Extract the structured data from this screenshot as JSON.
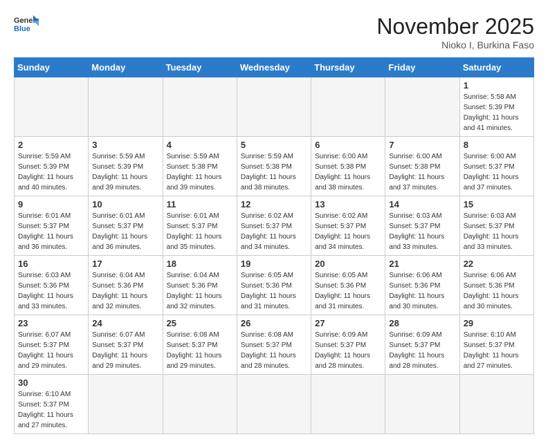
{
  "logo": {
    "text_general": "General",
    "text_blue": "Blue"
  },
  "header": {
    "month": "November 2025",
    "location": "Nioko I, Burkina Faso"
  },
  "weekdays": [
    "Sunday",
    "Monday",
    "Tuesday",
    "Wednesday",
    "Thursday",
    "Friday",
    "Saturday"
  ],
  "weeks": [
    [
      {
        "day": "",
        "sunrise": "",
        "sunset": "",
        "daylight": "",
        "empty": true
      },
      {
        "day": "",
        "sunrise": "",
        "sunset": "",
        "daylight": "",
        "empty": true
      },
      {
        "day": "",
        "sunrise": "",
        "sunset": "",
        "daylight": "",
        "empty": true
      },
      {
        "day": "",
        "sunrise": "",
        "sunset": "",
        "daylight": "",
        "empty": true
      },
      {
        "day": "",
        "sunrise": "",
        "sunset": "",
        "daylight": "",
        "empty": true
      },
      {
        "day": "",
        "sunrise": "",
        "sunset": "",
        "daylight": "",
        "empty": true
      },
      {
        "day": "1",
        "sunrise": "Sunrise: 5:58 AM",
        "sunset": "Sunset: 5:39 PM",
        "daylight": "Daylight: 11 hours and 41 minutes.",
        "empty": false
      }
    ],
    [
      {
        "day": "2",
        "sunrise": "Sunrise: 5:59 AM",
        "sunset": "Sunset: 5:39 PM",
        "daylight": "Daylight: 11 hours and 40 minutes.",
        "empty": false
      },
      {
        "day": "3",
        "sunrise": "Sunrise: 5:59 AM",
        "sunset": "Sunset: 5:39 PM",
        "daylight": "Daylight: 11 hours and 39 minutes.",
        "empty": false
      },
      {
        "day": "4",
        "sunrise": "Sunrise: 5:59 AM",
        "sunset": "Sunset: 5:38 PM",
        "daylight": "Daylight: 11 hours and 39 minutes.",
        "empty": false
      },
      {
        "day": "5",
        "sunrise": "Sunrise: 5:59 AM",
        "sunset": "Sunset: 5:38 PM",
        "daylight": "Daylight: 11 hours and 38 minutes.",
        "empty": false
      },
      {
        "day": "6",
        "sunrise": "Sunrise: 6:00 AM",
        "sunset": "Sunset: 5:38 PM",
        "daylight": "Daylight: 11 hours and 38 minutes.",
        "empty": false
      },
      {
        "day": "7",
        "sunrise": "Sunrise: 6:00 AM",
        "sunset": "Sunset: 5:38 PM",
        "daylight": "Daylight: 11 hours and 37 minutes.",
        "empty": false
      },
      {
        "day": "8",
        "sunrise": "Sunrise: 6:00 AM",
        "sunset": "Sunset: 5:37 PM",
        "daylight": "Daylight: 11 hours and 37 minutes.",
        "empty": false
      }
    ],
    [
      {
        "day": "9",
        "sunrise": "Sunrise: 6:01 AM",
        "sunset": "Sunset: 5:37 PM",
        "daylight": "Daylight: 11 hours and 36 minutes.",
        "empty": false
      },
      {
        "day": "10",
        "sunrise": "Sunrise: 6:01 AM",
        "sunset": "Sunset: 5:37 PM",
        "daylight": "Daylight: 11 hours and 36 minutes.",
        "empty": false
      },
      {
        "day": "11",
        "sunrise": "Sunrise: 6:01 AM",
        "sunset": "Sunset: 5:37 PM",
        "daylight": "Daylight: 11 hours and 35 minutes.",
        "empty": false
      },
      {
        "day": "12",
        "sunrise": "Sunrise: 6:02 AM",
        "sunset": "Sunset: 5:37 PM",
        "daylight": "Daylight: 11 hours and 34 minutes.",
        "empty": false
      },
      {
        "day": "13",
        "sunrise": "Sunrise: 6:02 AM",
        "sunset": "Sunset: 5:37 PM",
        "daylight": "Daylight: 11 hours and 34 minutes.",
        "empty": false
      },
      {
        "day": "14",
        "sunrise": "Sunrise: 6:03 AM",
        "sunset": "Sunset: 5:37 PM",
        "daylight": "Daylight: 11 hours and 33 minutes.",
        "empty": false
      },
      {
        "day": "15",
        "sunrise": "Sunrise: 6:03 AM",
        "sunset": "Sunset: 5:37 PM",
        "daylight": "Daylight: 11 hours and 33 minutes.",
        "empty": false
      }
    ],
    [
      {
        "day": "16",
        "sunrise": "Sunrise: 6:03 AM",
        "sunset": "Sunset: 5:36 PM",
        "daylight": "Daylight: 11 hours and 33 minutes.",
        "empty": false
      },
      {
        "day": "17",
        "sunrise": "Sunrise: 6:04 AM",
        "sunset": "Sunset: 5:36 PM",
        "daylight": "Daylight: 11 hours and 32 minutes.",
        "empty": false
      },
      {
        "day": "18",
        "sunrise": "Sunrise: 6:04 AM",
        "sunset": "Sunset: 5:36 PM",
        "daylight": "Daylight: 11 hours and 32 minutes.",
        "empty": false
      },
      {
        "day": "19",
        "sunrise": "Sunrise: 6:05 AM",
        "sunset": "Sunset: 5:36 PM",
        "daylight": "Daylight: 11 hours and 31 minutes.",
        "empty": false
      },
      {
        "day": "20",
        "sunrise": "Sunrise: 6:05 AM",
        "sunset": "Sunset: 5:36 PM",
        "daylight": "Daylight: 11 hours and 31 minutes.",
        "empty": false
      },
      {
        "day": "21",
        "sunrise": "Sunrise: 6:06 AM",
        "sunset": "Sunset: 5:36 PM",
        "daylight": "Daylight: 11 hours and 30 minutes.",
        "empty": false
      },
      {
        "day": "22",
        "sunrise": "Sunrise: 6:06 AM",
        "sunset": "Sunset: 5:36 PM",
        "daylight": "Daylight: 11 hours and 30 minutes.",
        "empty": false
      }
    ],
    [
      {
        "day": "23",
        "sunrise": "Sunrise: 6:07 AM",
        "sunset": "Sunset: 5:37 PM",
        "daylight": "Daylight: 11 hours and 29 minutes.",
        "empty": false
      },
      {
        "day": "24",
        "sunrise": "Sunrise: 6:07 AM",
        "sunset": "Sunset: 5:37 PM",
        "daylight": "Daylight: 11 hours and 29 minutes.",
        "empty": false
      },
      {
        "day": "25",
        "sunrise": "Sunrise: 6:08 AM",
        "sunset": "Sunset: 5:37 PM",
        "daylight": "Daylight: 11 hours and 29 minutes.",
        "empty": false
      },
      {
        "day": "26",
        "sunrise": "Sunrise: 6:08 AM",
        "sunset": "Sunset: 5:37 PM",
        "daylight": "Daylight: 11 hours and 28 minutes.",
        "empty": false
      },
      {
        "day": "27",
        "sunrise": "Sunrise: 6:09 AM",
        "sunset": "Sunset: 5:37 PM",
        "daylight": "Daylight: 11 hours and 28 minutes.",
        "empty": false
      },
      {
        "day": "28",
        "sunrise": "Sunrise: 6:09 AM",
        "sunset": "Sunset: 5:37 PM",
        "daylight": "Daylight: 11 hours and 28 minutes.",
        "empty": false
      },
      {
        "day": "29",
        "sunrise": "Sunrise: 6:10 AM",
        "sunset": "Sunset: 5:37 PM",
        "daylight": "Daylight: 11 hours and 27 minutes.",
        "empty": false
      }
    ],
    [
      {
        "day": "30",
        "sunrise": "Sunrise: 6:10 AM",
        "sunset": "Sunset: 5:37 PM",
        "daylight": "Daylight: 11 hours and 27 minutes.",
        "empty": false,
        "last": true
      },
      {
        "day": "",
        "sunrise": "",
        "sunset": "",
        "daylight": "",
        "empty": true,
        "last": true
      },
      {
        "day": "",
        "sunrise": "",
        "sunset": "",
        "daylight": "",
        "empty": true,
        "last": true
      },
      {
        "day": "",
        "sunrise": "",
        "sunset": "",
        "daylight": "",
        "empty": true,
        "last": true
      },
      {
        "day": "",
        "sunrise": "",
        "sunset": "",
        "daylight": "",
        "empty": true,
        "last": true
      },
      {
        "day": "",
        "sunrise": "",
        "sunset": "",
        "daylight": "",
        "empty": true,
        "last": true
      },
      {
        "day": "",
        "sunrise": "",
        "sunset": "",
        "daylight": "",
        "empty": true,
        "last": true
      }
    ]
  ]
}
